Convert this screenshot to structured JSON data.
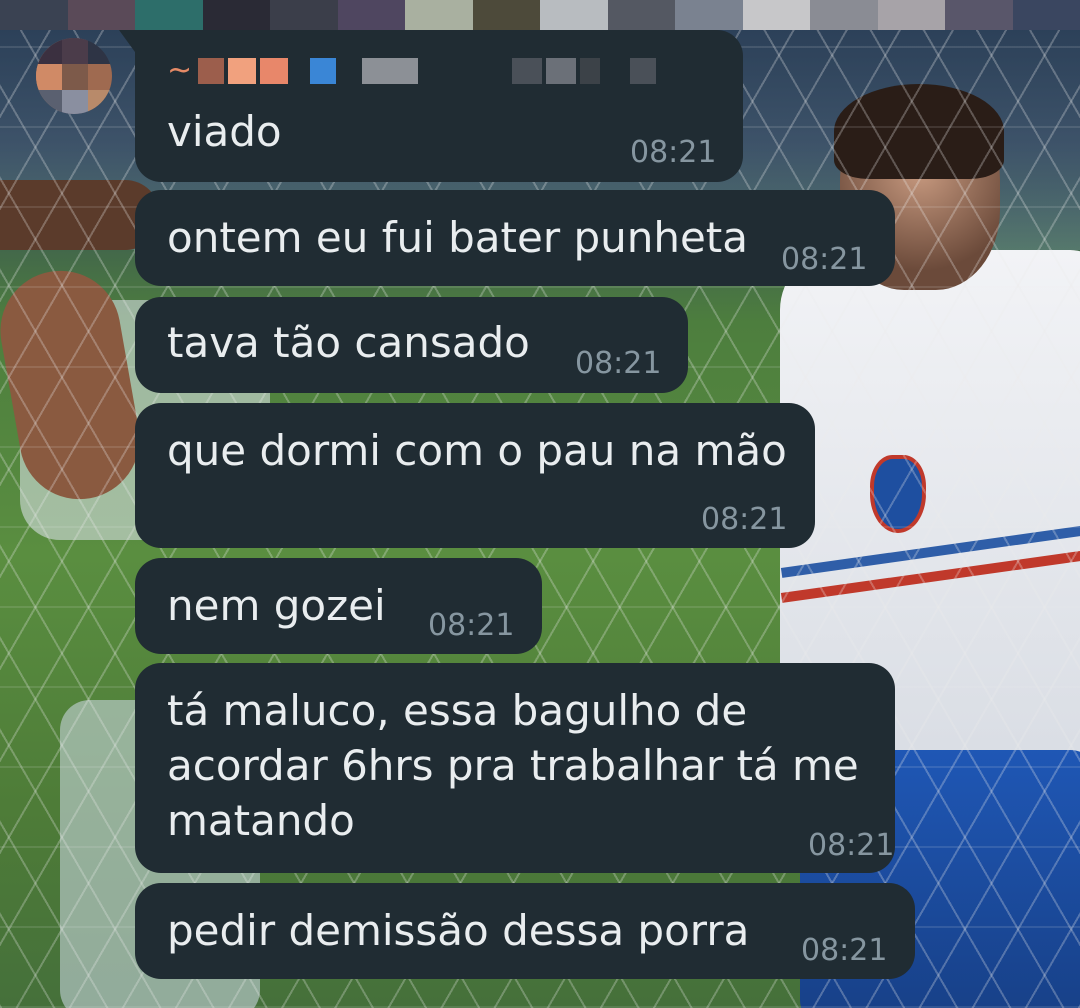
{
  "chat": {
    "sender_prefix": "~",
    "messages": [
      {
        "text": "viado",
        "time": "08:21"
      },
      {
        "text": "ontem eu fui bater punheta",
        "time": "08:21"
      },
      {
        "text": "tava tão cansado",
        "time": "08:21"
      },
      {
        "text": "que dormi com o pau na mão",
        "time": "08:21"
      },
      {
        "text": "nem gozei",
        "time": "08:21"
      },
      {
        "text": "tá maluco, essa bagulho de acordar 6hrs pra trabalhar tá me matando",
        "time": "08:21"
      },
      {
        "text": "pedir demissão dessa porra",
        "time": "08:21"
      }
    ]
  },
  "colors": {
    "bubble_bg": "#202c33",
    "message_text": "#e9edef",
    "timestamp": "#8696a0",
    "sender_name": "#e58a66"
  },
  "icons": {
    "avatar": "contact-avatar-pixelated"
  }
}
